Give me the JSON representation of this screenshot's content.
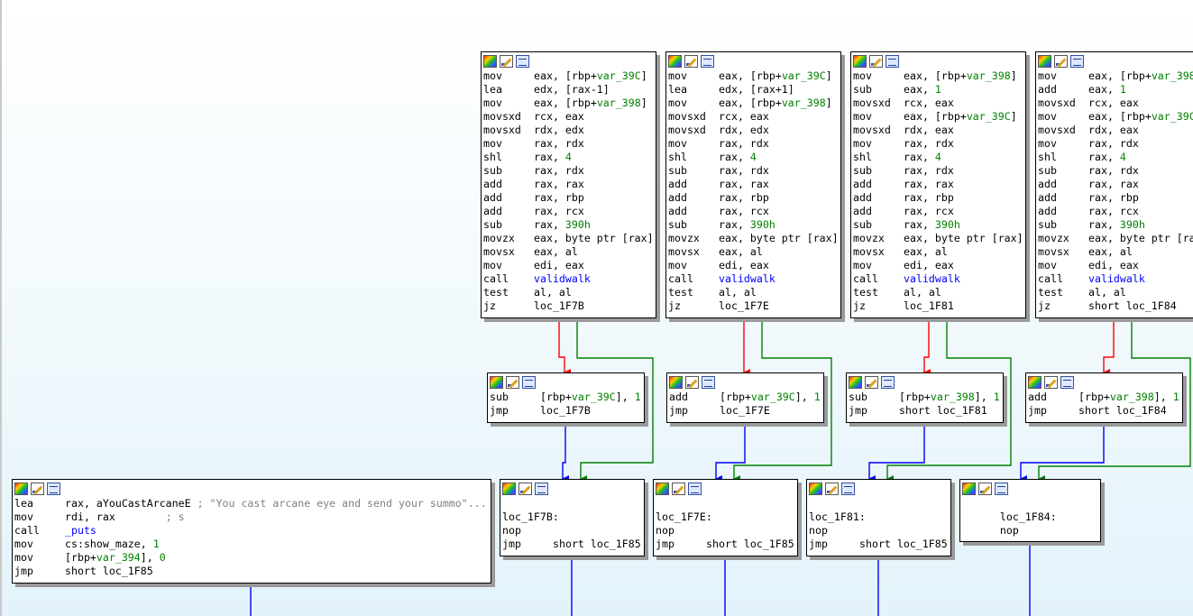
{
  "blocks": [
    {
      "id": "b1",
      "lines": [
        {
          "m": "mov",
          "p": [
            {
              "t": "eax, [rbp+"
            },
            {
              "t": "var_39C",
              "c": "g"
            },
            {
              "t": "]"
            }
          ]
        },
        {
          "m": "lea",
          "p": [
            {
              "t": "edx, [rax-1]"
            }
          ]
        },
        {
          "m": "mov",
          "p": [
            {
              "t": "eax, [rbp+"
            },
            {
              "t": "var_398",
              "c": "g"
            },
            {
              "t": "]"
            }
          ]
        },
        {
          "m": "movsxd",
          "p": [
            {
              "t": "rcx, eax"
            }
          ]
        },
        {
          "m": "movsxd",
          "p": [
            {
              "t": "rdx, edx"
            }
          ]
        },
        {
          "m": "mov",
          "p": [
            {
              "t": "rax, rdx"
            }
          ]
        },
        {
          "m": "shl",
          "p": [
            {
              "t": "rax, "
            },
            {
              "t": "4",
              "c": "g"
            }
          ]
        },
        {
          "m": "sub",
          "p": [
            {
              "t": "rax, rdx"
            }
          ]
        },
        {
          "m": "add",
          "p": [
            {
              "t": "rax, rax"
            }
          ]
        },
        {
          "m": "add",
          "p": [
            {
              "t": "rax, rbp"
            }
          ]
        },
        {
          "m": "add",
          "p": [
            {
              "t": "rax, rcx"
            }
          ]
        },
        {
          "m": "sub",
          "p": [
            {
              "t": "rax, "
            },
            {
              "t": "390h",
              "c": "g"
            }
          ]
        },
        {
          "m": "movzx",
          "p": [
            {
              "t": "eax, byte ptr [rax]"
            }
          ]
        },
        {
          "m": "movsx",
          "p": [
            {
              "t": "eax, al"
            }
          ]
        },
        {
          "m": "mov",
          "p": [
            {
              "t": "edi, eax"
            }
          ]
        },
        {
          "m": "call",
          "p": [
            {
              "t": "validwalk",
              "c": "b"
            }
          ]
        },
        {
          "m": "test",
          "p": [
            {
              "t": "al, al"
            }
          ]
        },
        {
          "m": "jz",
          "p": [
            {
              "t": "loc_1F7B"
            }
          ]
        }
      ]
    },
    {
      "id": "b2",
      "lines": [
        {
          "m": "mov",
          "p": [
            {
              "t": "eax, [rbp+"
            },
            {
              "t": "var_39C",
              "c": "g"
            },
            {
              "t": "]"
            }
          ]
        },
        {
          "m": "lea",
          "p": [
            {
              "t": "edx, [rax+1]"
            }
          ]
        },
        {
          "m": "mov",
          "p": [
            {
              "t": "eax, [rbp+"
            },
            {
              "t": "var_398",
              "c": "g"
            },
            {
              "t": "]"
            }
          ]
        },
        {
          "m": "movsxd",
          "p": [
            {
              "t": "rcx, eax"
            }
          ]
        },
        {
          "m": "movsxd",
          "p": [
            {
              "t": "rdx, edx"
            }
          ]
        },
        {
          "m": "mov",
          "p": [
            {
              "t": "rax, rdx"
            }
          ]
        },
        {
          "m": "shl",
          "p": [
            {
              "t": "rax, "
            },
            {
              "t": "4",
              "c": "g"
            }
          ]
        },
        {
          "m": "sub",
          "p": [
            {
              "t": "rax, rdx"
            }
          ]
        },
        {
          "m": "add",
          "p": [
            {
              "t": "rax, rax"
            }
          ]
        },
        {
          "m": "add",
          "p": [
            {
              "t": "rax, rbp"
            }
          ]
        },
        {
          "m": "add",
          "p": [
            {
              "t": "rax, rcx"
            }
          ]
        },
        {
          "m": "sub",
          "p": [
            {
              "t": "rax, "
            },
            {
              "t": "390h",
              "c": "g"
            }
          ]
        },
        {
          "m": "movzx",
          "p": [
            {
              "t": "eax, byte ptr [rax]"
            }
          ]
        },
        {
          "m": "movsx",
          "p": [
            {
              "t": "eax, al"
            }
          ]
        },
        {
          "m": "mov",
          "p": [
            {
              "t": "edi, eax"
            }
          ]
        },
        {
          "m": "call",
          "p": [
            {
              "t": "validwalk",
              "c": "b"
            }
          ]
        },
        {
          "m": "test",
          "p": [
            {
              "t": "al, al"
            }
          ]
        },
        {
          "m": "jz",
          "p": [
            {
              "t": "loc_1F7E"
            }
          ]
        }
      ]
    },
    {
      "id": "b3",
      "lines": [
        {
          "m": "mov",
          "p": [
            {
              "t": "eax, [rbp+"
            },
            {
              "t": "var_398",
              "c": "g"
            },
            {
              "t": "]"
            }
          ]
        },
        {
          "m": "sub",
          "p": [
            {
              "t": "eax, "
            },
            {
              "t": "1",
              "c": "g"
            }
          ]
        },
        {
          "m": "movsxd",
          "p": [
            {
              "t": "rcx, eax"
            }
          ]
        },
        {
          "m": "mov",
          "p": [
            {
              "t": "eax, [rbp+"
            },
            {
              "t": "var_39C",
              "c": "g"
            },
            {
              "t": "]"
            }
          ]
        },
        {
          "m": "movsxd",
          "p": [
            {
              "t": "rdx, eax"
            }
          ]
        },
        {
          "m": "mov",
          "p": [
            {
              "t": "rax, rdx"
            }
          ]
        },
        {
          "m": "shl",
          "p": [
            {
              "t": "rax, "
            },
            {
              "t": "4",
              "c": "g"
            }
          ]
        },
        {
          "m": "sub",
          "p": [
            {
              "t": "rax, rdx"
            }
          ]
        },
        {
          "m": "add",
          "p": [
            {
              "t": "rax, rax"
            }
          ]
        },
        {
          "m": "add",
          "p": [
            {
              "t": "rax, rbp"
            }
          ]
        },
        {
          "m": "add",
          "p": [
            {
              "t": "rax, rcx"
            }
          ]
        },
        {
          "m": "sub",
          "p": [
            {
              "t": "rax, "
            },
            {
              "t": "390h",
              "c": "g"
            }
          ]
        },
        {
          "m": "movzx",
          "p": [
            {
              "t": "eax, byte ptr [rax]"
            }
          ]
        },
        {
          "m": "movsx",
          "p": [
            {
              "t": "eax, al"
            }
          ]
        },
        {
          "m": "mov",
          "p": [
            {
              "t": "edi, eax"
            }
          ]
        },
        {
          "m": "call",
          "p": [
            {
              "t": "validwalk",
              "c": "b"
            }
          ]
        },
        {
          "m": "test",
          "p": [
            {
              "t": "al, al"
            }
          ]
        },
        {
          "m": "jz",
          "p": [
            {
              "t": "loc_1F81"
            }
          ]
        }
      ]
    },
    {
      "id": "b4",
      "lines": [
        {
          "m": "mov",
          "p": [
            {
              "t": "eax, [rbp+"
            },
            {
              "t": "var_398",
              "c": "g"
            }
          ]
        },
        {
          "m": "add",
          "p": [
            {
              "t": "eax, "
            },
            {
              "t": "1",
              "c": "g"
            }
          ]
        },
        {
          "m": "movsxd",
          "p": [
            {
              "t": "rcx, eax"
            }
          ]
        },
        {
          "m": "mov",
          "p": [
            {
              "t": "eax, [rbp+"
            },
            {
              "t": "var_39C",
              "c": "g"
            }
          ]
        },
        {
          "m": "movsxd",
          "p": [
            {
              "t": "rdx, eax"
            }
          ]
        },
        {
          "m": "mov",
          "p": [
            {
              "t": "rax, rdx"
            }
          ]
        },
        {
          "m": "shl",
          "p": [
            {
              "t": "rax, "
            },
            {
              "t": "4",
              "c": "g"
            }
          ]
        },
        {
          "m": "sub",
          "p": [
            {
              "t": "rax, rdx"
            }
          ]
        },
        {
          "m": "add",
          "p": [
            {
              "t": "rax, rax"
            }
          ]
        },
        {
          "m": "add",
          "p": [
            {
              "t": "rax, rbp"
            }
          ]
        },
        {
          "m": "add",
          "p": [
            {
              "t": "rax, rcx"
            }
          ]
        },
        {
          "m": "sub",
          "p": [
            {
              "t": "rax, "
            },
            {
              "t": "390h",
              "c": "g"
            }
          ]
        },
        {
          "m": "movzx",
          "p": [
            {
              "t": "eax, byte ptr [ra"
            }
          ]
        },
        {
          "m": "movsx",
          "p": [
            {
              "t": "eax, al"
            }
          ]
        },
        {
          "m": "mov",
          "p": [
            {
              "t": "edi, eax"
            }
          ]
        },
        {
          "m": "call",
          "p": [
            {
              "t": "validwalk",
              "c": "b"
            }
          ]
        },
        {
          "m": "test",
          "p": [
            {
              "t": "al, al"
            }
          ]
        },
        {
          "m": "jz",
          "p": [
            {
              "t": "short loc_1F84"
            }
          ]
        }
      ]
    },
    {
      "id": "s1",
      "lines": [
        {
          "m": "sub",
          "p": [
            {
              "t": "[rbp+"
            },
            {
              "t": "var_39C",
              "c": "g"
            },
            {
              "t": "], "
            },
            {
              "t": "1",
              "c": "g"
            }
          ]
        },
        {
          "m": "jmp",
          "p": [
            {
              "t": "loc_1F7B"
            }
          ]
        }
      ]
    },
    {
      "id": "s2",
      "lines": [
        {
          "m": "add",
          "p": [
            {
              "t": "[rbp+"
            },
            {
              "t": "var_39C",
              "c": "g"
            },
            {
              "t": "], "
            },
            {
              "t": "1",
              "c": "g"
            }
          ]
        },
        {
          "m": "jmp",
          "p": [
            {
              "t": "loc_1F7E"
            }
          ]
        }
      ]
    },
    {
      "id": "s3",
      "lines": [
        {
          "m": "sub",
          "p": [
            {
              "t": "[rbp+"
            },
            {
              "t": "var_398",
              "c": "g"
            },
            {
              "t": "], "
            },
            {
              "t": "1",
              "c": "g"
            }
          ]
        },
        {
          "m": "jmp",
          "p": [
            {
              "t": "short loc_1F81"
            }
          ]
        }
      ]
    },
    {
      "id": "s4",
      "lines": [
        {
          "m": "add",
          "p": [
            {
              "t": "[rbp+"
            },
            {
              "t": "var_398",
              "c": "g"
            },
            {
              "t": "], "
            },
            {
              "t": "1",
              "c": "g"
            }
          ]
        },
        {
          "m": "jmp",
          "p": [
            {
              "t": "short loc_1F84"
            }
          ]
        }
      ]
    },
    {
      "id": "L",
      "lines": [
        {
          "m": "lea",
          "p": [
            {
              "t": "rax, aYouCastArcaneE "
            },
            {
              "t": "; \"You cast arcane eye and send your summo\"...",
              "c": "cm"
            }
          ]
        },
        {
          "m": "mov",
          "p": [
            {
              "t": "rdi, rax        "
            },
            {
              "t": "; s",
              "c": "cm"
            }
          ]
        },
        {
          "m": "call",
          "p": [
            {
              "t": "_puts",
              "c": "b"
            }
          ]
        },
        {
          "m": "mov",
          "p": [
            {
              "t": "cs:show_maze, "
            },
            {
              "t": "1",
              "c": "g"
            }
          ]
        },
        {
          "m": "mov",
          "p": [
            {
              "t": "[rbp+"
            },
            {
              "t": "var_394",
              "c": "g"
            },
            {
              "t": "], "
            },
            {
              "t": "0",
              "c": "g"
            }
          ]
        },
        {
          "m": "jmp",
          "p": [
            {
              "t": "short loc_1F85"
            }
          ]
        }
      ]
    },
    {
      "id": "l1",
      "lines": [
        {
          "m": "",
          "p": [
            {
              "t": ""
            }
          ]
        },
        {
          "m": "loc_1F7B:",
          "p": [
            {
              "t": ""
            }
          ]
        },
        {
          "m": "nop",
          "p": [
            {
              "t": ""
            }
          ]
        },
        {
          "m": "jmp",
          "p": [
            {
              "t": "short loc_1F85"
            }
          ]
        }
      ]
    },
    {
      "id": "l2",
      "lines": [
        {
          "m": "",
          "p": [
            {
              "t": ""
            }
          ]
        },
        {
          "m": "loc_1F7E:",
          "p": [
            {
              "t": ""
            }
          ]
        },
        {
          "m": "nop",
          "p": [
            {
              "t": ""
            }
          ]
        },
        {
          "m": "jmp",
          "p": [
            {
              "t": "short loc_1F85"
            }
          ]
        }
      ]
    },
    {
      "id": "l3",
      "lines": [
        {
          "m": "",
          "p": [
            {
              "t": ""
            }
          ]
        },
        {
          "m": "loc_1F81:",
          "p": [
            {
              "t": ""
            }
          ]
        },
        {
          "m": "nop",
          "p": [
            {
              "t": ""
            }
          ]
        },
        {
          "m": "jmp",
          "p": [
            {
              "t": "short loc_1F85"
            }
          ]
        }
      ]
    },
    {
      "id": "l4",
      "lines": [
        {
          "m": "",
          "p": [
            {
              "t": ""
            }
          ]
        },
        {
          "m": "      loc_1F84:",
          "p": [
            {
              "t": ""
            }
          ]
        },
        {
          "m": "      nop",
          "p": [
            {
              "t": ""
            }
          ]
        }
      ]
    }
  ],
  "icons": {
    "node_color": "node-color-icon",
    "node_rename": "node-rename-icon",
    "node_group": "node-group-icon"
  },
  "colors": {
    "true_edge": "#008000",
    "false_edge": "#ff0000",
    "uncond_edge": "#0000ff",
    "node_border": "#000000",
    "background": "#e3f3fb"
  }
}
